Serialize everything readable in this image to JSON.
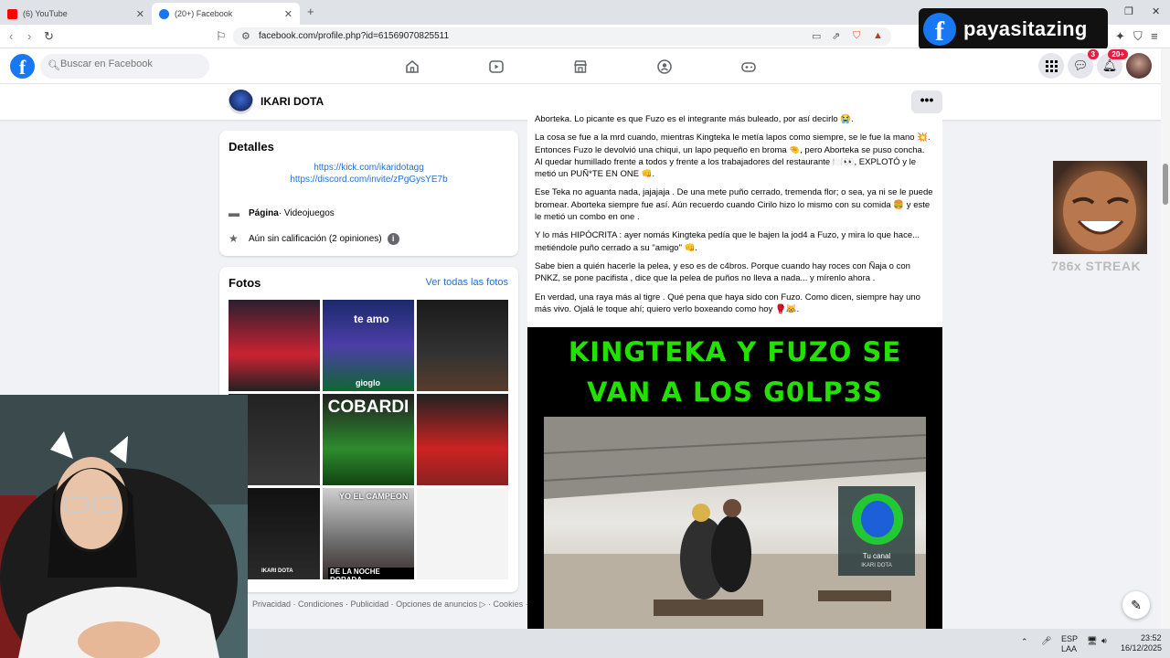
{
  "browser": {
    "tabs": [
      {
        "label": "(6) YouTube",
        "favicon_color": "#ff0000"
      },
      {
        "label": "(20+) Facebook",
        "favicon_color": "#1877f2",
        "active": true
      }
    ],
    "url": "facebook.com/profile.php?id=61569070825511"
  },
  "overlay": {
    "brand": "payasitazing"
  },
  "fb": {
    "logo": "f",
    "search_placeholder": "Buscar en Facebook",
    "messenger_badge": "3",
    "notif_badge": "20+"
  },
  "page": {
    "name": "IKARI DOTA",
    "more": "•••"
  },
  "details": {
    "title": "Detalles",
    "links": [
      "https://kick.com/ikaridotagg",
      "https://discord.com/invite/zPgGysYE7b"
    ],
    "category_label": "Página",
    "category_value": " · Videojuegos",
    "rating": "Aún sin calificación (2 opiniones)"
  },
  "photos": {
    "title": "Fotos",
    "see_all": "Ver todas las fotos",
    "captions": [
      "te amo",
      "gioglo",
      "COBARDI",
      "YO EL CAMPEON",
      "DE LA NOCHE DORADA",
      "IKARI DOTA"
    ]
  },
  "footer": "Privacidad · Condiciones · Publicidad · Opciones de anuncios ▷ · Cookies · Más",
  "post": {
    "paragraphs": [
      "Aborteka. Lo picante es que Fuzo es el integrante más buleado, por así decirlo 😭.",
      "La cosa se fue a la mrd cuando, mientras Kingteka le metía lapos como siempre, se le fue la mano 💥. Entonces Fuzo le devolvió una chiqui, un lapo pequeño en broma 🤏, pero Aborteka se puso concha.\nAl quedar humillado frente a todos y frente a los trabajadores del restaurante 🍽️👀, EXPLOTÓ y le metió un PUÑ*TE EN ONE 👊.",
      "Ese Teka no aguanta nada, jajajaja . De una mete puño cerrado, tremenda flor; o sea, ya ni se le puede bromear. Aborteka siempre fue así. Aún recuerdo cuando Cirilo hizo lo mismo con su comida 🍔 y este le metió un combo en one .",
      "Y lo más HIPÓCRITA : ayer nomás Kingteka pedía que le bajen la jod4 a Fuzo, y mira lo que hace... metiéndole puño cerrado a su \"amigo\" 👊.",
      "Sabe bien a quién hacerle la pelea, y eso es de c4bros. Porque cuando hay roces con Ñaja o con PNKZ, se pone pacifista , dice que la pelea de puños no lleva a nada... y mírenlo ahora .",
      "En verdad, una raya más al tigre . Qué pena que haya sido con Fuzo. Como dicen, siempre hay uno más vivo. Ojalá le toque ahí; quiero verlo boxeando como hoy 🥊😹."
    ],
    "video_title_line1": "KINGTEKA Y FUZO SE",
    "video_title_line2": "VAN A LOS G0LP3S",
    "video_watermark_label": "Tu canal",
    "video_watermark_name": "IKARI DOTA"
  },
  "side_overlay": {
    "text": "786x STREAK"
  },
  "taskbar": {
    "lang1": "ESP",
    "lang2": "LAA",
    "time": "23:52",
    "date": "16/12/2025"
  }
}
